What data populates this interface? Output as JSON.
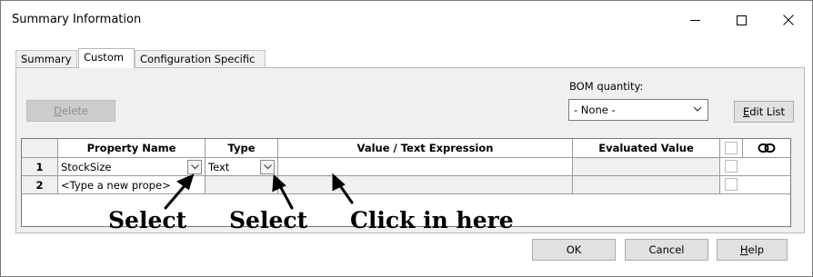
{
  "window": {
    "title": "Summary Information",
    "minimize_icon": "minimize-icon",
    "maximize_icon": "maximize-icon",
    "close_icon": "close-icon"
  },
  "tabs": [
    {
      "label": "Summary",
      "active": false
    },
    {
      "label": "Custom",
      "active": true
    },
    {
      "label": "Configuration Specific",
      "active": false
    }
  ],
  "toolbar": {
    "delete_label": "Delete",
    "delete_mnemonic": "D",
    "bom_label": "BOM quantity:",
    "bom_value": "- None -",
    "edit_list_label": "Edit List",
    "edit_list_mnemonic": "E"
  },
  "table": {
    "columns": [
      "",
      "Property Name",
      "Type",
      "Value / Text Expression",
      "Evaluated Value",
      "",
      "link-icon"
    ],
    "rows": [
      {
        "num": "1",
        "property": "StockSize",
        "type": "Text",
        "value": "",
        "evaluated": ""
      },
      {
        "num": "2",
        "property": "<Type a new prope>",
        "type": "",
        "value": "",
        "evaluated": ""
      }
    ]
  },
  "annotations": {
    "select_1": "Select",
    "select_2": "Select",
    "click_here": "Click in here"
  },
  "footer": {
    "ok_label": "OK",
    "cancel_label": "Cancel",
    "help_label": "Help",
    "help_mnemonic": "H"
  },
  "colors": {
    "panel_bg": "#f0f0f0",
    "button_bg": "#e1e1e1",
    "disabled_text": "#8d8d8d"
  }
}
